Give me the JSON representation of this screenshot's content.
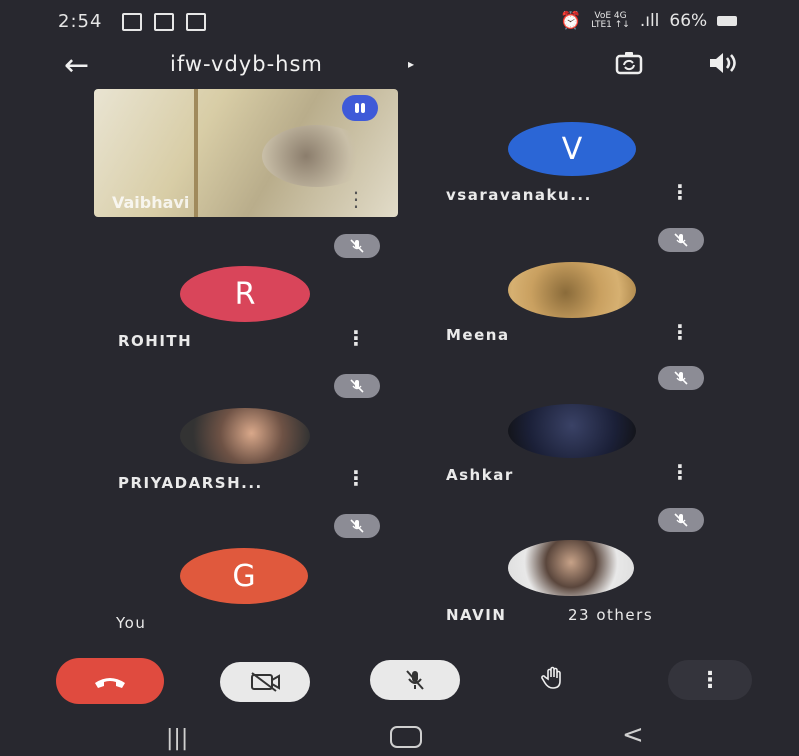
{
  "status": {
    "time": "2:54",
    "battery": "66%",
    "signal_label_top": "VoE 4G",
    "signal_label_bottom": "LTE1 ↑↓"
  },
  "header": {
    "meeting_code": "ifw-vdyb-hsm",
    "caret": "▸"
  },
  "self_preview": {
    "name": "Vaibhavi"
  },
  "participants": [
    {
      "name": "vsaravanaku...",
      "initial": "V",
      "color": "#2b66d6"
    },
    {
      "name": "ROHITH",
      "initial": "R",
      "color": "#d9455a"
    },
    {
      "name": "Meena"
    },
    {
      "name": "PRIYADARSH..."
    },
    {
      "name": "Ashkar"
    },
    {
      "name": "You",
      "initial": "G",
      "color": "#e0593d"
    },
    {
      "name": "NAVIN"
    }
  ],
  "overflow": {
    "label": "23 others"
  },
  "controls": {
    "end_call_color": "#e04b3f",
    "button_color": "#e9e9e9"
  },
  "icons": {
    "back": "arrow-left-icon",
    "switch_camera": "switch-camera-icon",
    "speaker": "speaker-icon",
    "muted": "mic-off-icon",
    "more": "more-vertical-icon",
    "hang_up": "phone-hangup-icon",
    "camera_off": "camera-off-icon",
    "mic_off": "mic-off-icon",
    "raise_hand": "hand-icon"
  }
}
